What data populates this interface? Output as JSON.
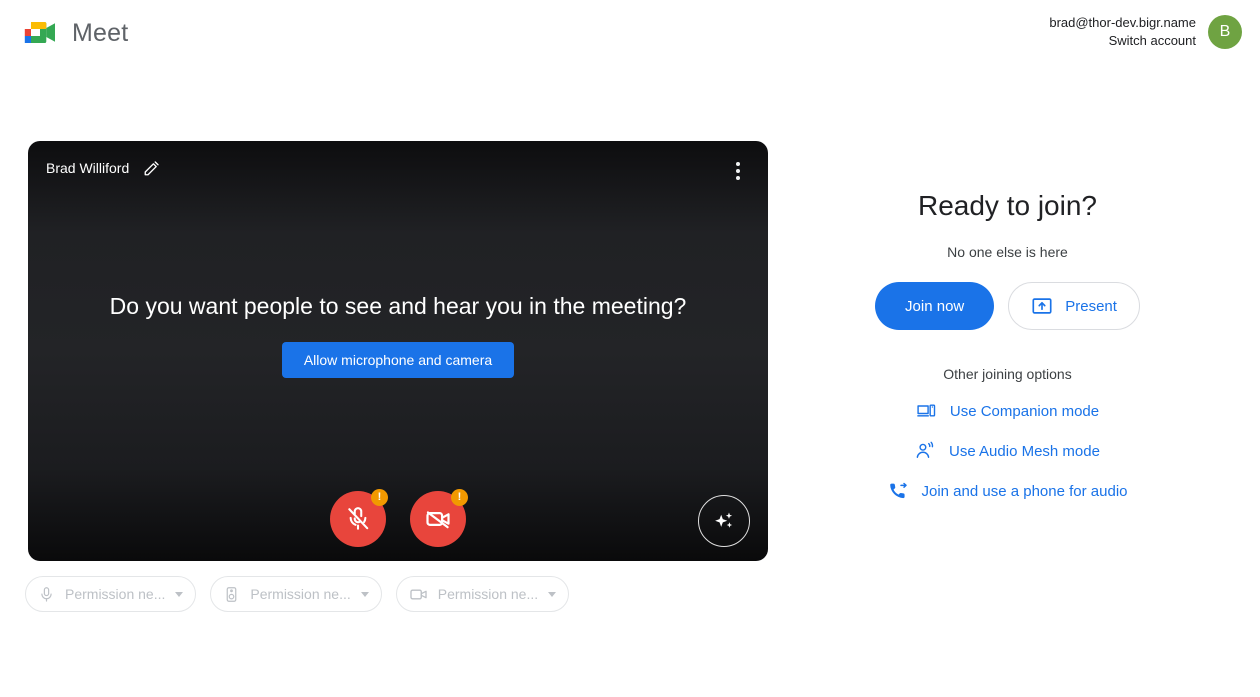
{
  "header": {
    "brand_name": "Meet",
    "logo_icon": "google-meet-logo",
    "account_email": "brad@thor-dev.bigr.name",
    "switch_account_label": "Switch account",
    "avatar_initial": "B",
    "avatar_color": "#6fa342"
  },
  "preview": {
    "user_name": "Brad Williford",
    "edit_icon": "pencil-icon",
    "more_options_icon": "more-vertical-icon",
    "question": "Do you want people to see and hear you in the meeting?",
    "allow_button_label": "Allow microphone and camera",
    "mic_button": {
      "icon": "mic-off-icon",
      "badge": "!",
      "color": "#e8453c",
      "badge_color": "#f29900"
    },
    "camera_button": {
      "icon": "video-off-icon",
      "badge": "!",
      "color": "#e8453c",
      "badge_color": "#f29900"
    },
    "effects_button": {
      "icon": "sparkle-icon"
    }
  },
  "device_chips": [
    {
      "icon": "microphone-icon",
      "label": "Permission ne...",
      "caret": "chevron-down-icon"
    },
    {
      "icon": "speaker-icon",
      "label": "Permission ne...",
      "caret": "chevron-down-icon"
    },
    {
      "icon": "camera-icon",
      "label": "Permission ne...",
      "caret": "chevron-down-icon"
    }
  ],
  "right_panel": {
    "title": "Ready to join?",
    "subtitle": "No one else is here",
    "join_now_label": "Join now",
    "present_label": "Present",
    "present_icon": "present-screen-icon",
    "other_options_title": "Other joining options",
    "options": [
      {
        "icon": "companion-device-icon",
        "label": "Use Companion mode"
      },
      {
        "icon": "audio-mesh-person-icon",
        "label": "Use Audio Mesh mode"
      },
      {
        "icon": "phone-forward-icon",
        "label": "Join and use a phone for audio"
      }
    ],
    "accent_color": "#1a73e8"
  }
}
